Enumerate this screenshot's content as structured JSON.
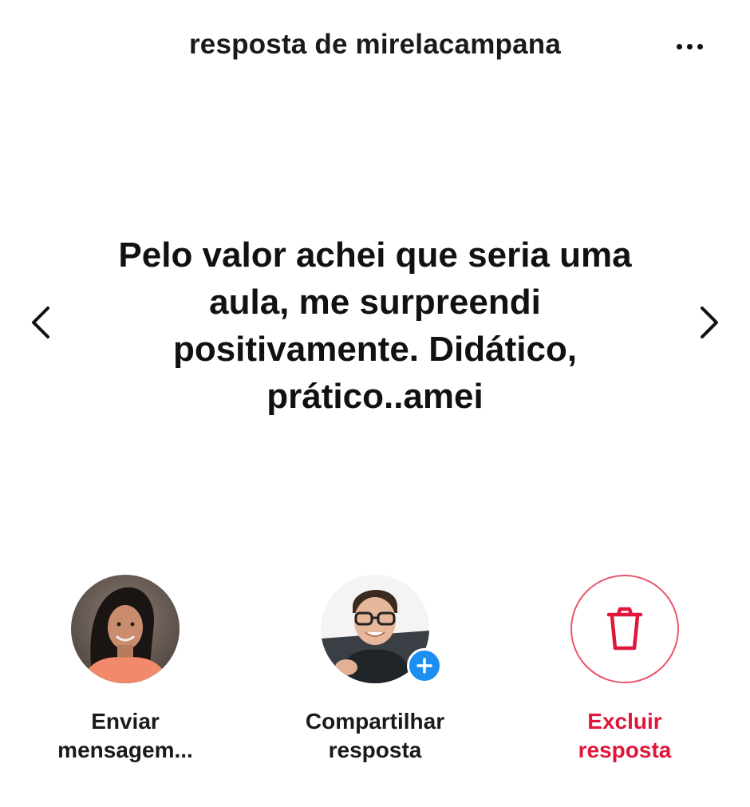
{
  "header": {
    "title": "resposta de mirelacampana",
    "more_icon": "more-horizontal-icon"
  },
  "navigation": {
    "prev_icon": "chevron-left-icon",
    "next_icon": "chevron-right-icon"
  },
  "response": {
    "text": "Pelo valor achei que seria uma aula, me surpreendi positivamente. Didático, prático..amei"
  },
  "actions": [
    {
      "label": "Enviar\nmensagem...",
      "icon": "user-avatar"
    },
    {
      "label": "Compartilhar\nresposta",
      "icon": "profile-avatar-with-plus"
    },
    {
      "label": "Excluir\nresposta",
      "icon": "trash-icon",
      "color": "#e0163b"
    }
  ],
  "colors": {
    "danger": "#e0163b",
    "danger_border": "#e8566c",
    "badge_blue": "#1c8ef0",
    "text": "#111111"
  }
}
